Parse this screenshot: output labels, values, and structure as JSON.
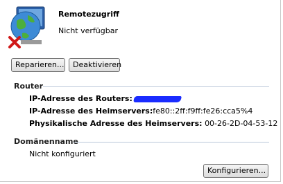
{
  "header": {
    "title": "Remotezugriff",
    "status": "Nicht verfügbar"
  },
  "buttons": {
    "repair": "Reparieren...",
    "deactivate": "Deaktivieren",
    "configure": "Konfigurieren..."
  },
  "router": {
    "heading": "Router",
    "ip_router_label": "IP-Adresse des Routers:",
    "ip_home_label": "IP-Adresse des Heimservers:",
    "ip_home_value": "fe80::2ff:f9ff:fe26:cca5%4",
    "mac_label": "Physikalische Adresse des Heimservers:",
    "mac_value": "00-26-2D-04-53-12"
  },
  "domain": {
    "heading": "Domänenname",
    "value": "Nicht konfiguriert"
  },
  "colors": {
    "redaction": "#1a2cff",
    "separator": "#b9c6d8"
  },
  "icons": {
    "header": "network-computer-error-icon"
  }
}
